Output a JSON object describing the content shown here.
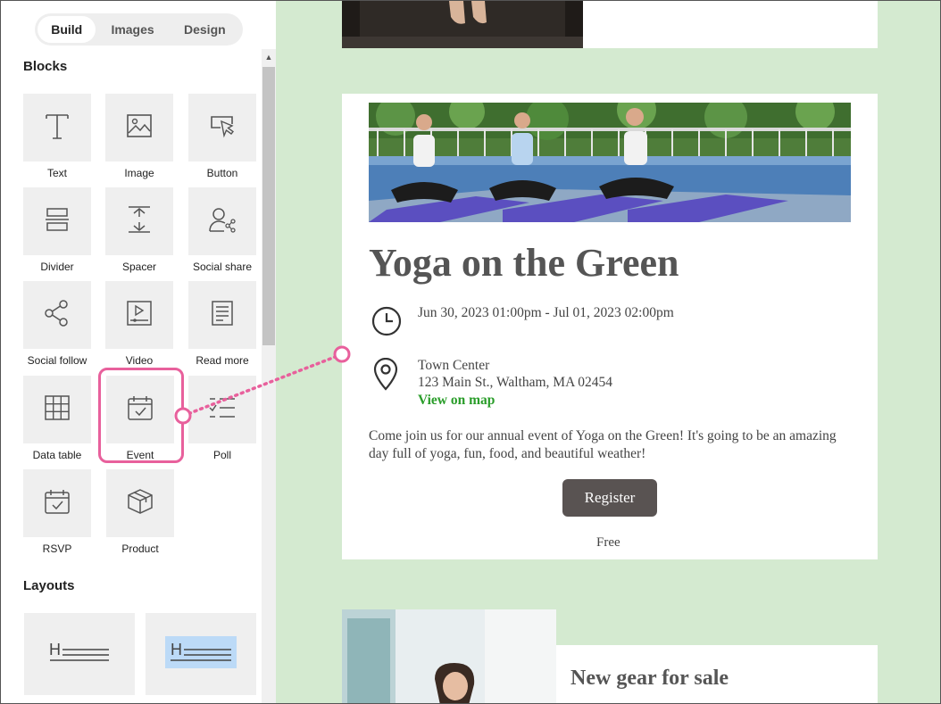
{
  "tabs": [
    "Build",
    "Images",
    "Design"
  ],
  "sections": {
    "blocks": "Blocks",
    "layouts": "Layouts"
  },
  "blocks": [
    {
      "label": "Text",
      "icon": "text-icon"
    },
    {
      "label": "Image",
      "icon": "image-icon"
    },
    {
      "label": "Button",
      "icon": "button-icon"
    },
    {
      "label": "Divider",
      "icon": "divider-icon"
    },
    {
      "label": "Spacer",
      "icon": "spacer-icon"
    },
    {
      "label": "Social share",
      "icon": "social-share-icon"
    },
    {
      "label": "Social follow",
      "icon": "social-follow-icon"
    },
    {
      "label": "Video",
      "icon": "video-icon"
    },
    {
      "label": "Read more",
      "icon": "read-more-icon"
    },
    {
      "label": "Data table",
      "icon": "data-table-icon"
    },
    {
      "label": "Event",
      "icon": "event-icon"
    },
    {
      "label": "Poll",
      "icon": "poll-icon"
    },
    {
      "label": "RSVP",
      "icon": "rsvp-icon"
    },
    {
      "label": "Product",
      "icon": "product-icon"
    }
  ],
  "layouts": [
    {
      "icon": "heading-lines-icon"
    },
    {
      "icon": "heading-lines-highlighted-icon"
    }
  ],
  "event": {
    "title": "Yoga on the Green",
    "datetime": "Jun 30, 2023 01:00pm - Jul 01, 2023 02:00pm",
    "location_name": "Town Center",
    "address": "123 Main St., Waltham, MA 02454",
    "map_link": "View on map",
    "description": "Come join us for our annual event of Yoga on the Green! It's going to be an amazing day full of yoga, fun, food, and beautiful weather!",
    "register_label": "Register",
    "price": "Free"
  },
  "gear": {
    "title": "New gear for sale"
  },
  "colors": {
    "canvas_bg": "#d4ead0",
    "highlight": "#e8609c",
    "link": "#2a9d2a",
    "button": "#595352"
  }
}
